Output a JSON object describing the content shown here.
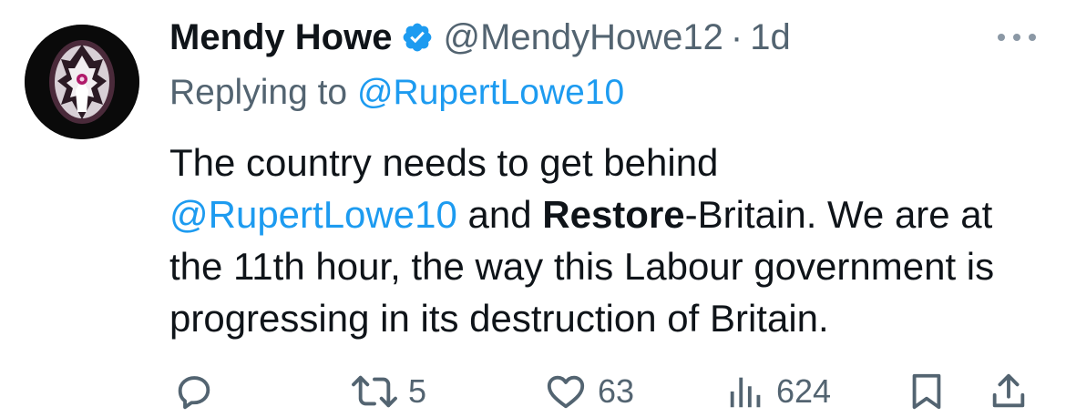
{
  "tweet": {
    "author_name": "Mendy Howe",
    "author_handle": "@MendyHowe12",
    "separator": "·",
    "time": "1d",
    "replying_label": "Replying to",
    "replying_to": "@RupertLowe10",
    "body": {
      "line1": "The country needs to get behind",
      "mention": "@RupertLowe10",
      "and": " and ",
      "bold": "Restore",
      "rest": "-Britain. We are at the 11th hour, the way this Labour government is progressing in its destruction of Britain."
    }
  },
  "stats": {
    "retweets": "5",
    "likes": "63",
    "views": "624"
  },
  "icons": {
    "more": "more-dots-icon",
    "reply": "reply-bubble-icon",
    "retweet": "retweet-icon",
    "like": "heart-icon",
    "views": "bar-chart-icon",
    "bookmark": "bookmark-icon",
    "share": "share-upload-icon",
    "verified": "verified-badge-icon"
  },
  "colors": {
    "text": "#0f1419",
    "muted": "#536471",
    "link": "#1d9bf0",
    "verified": "#1d9bf0"
  }
}
